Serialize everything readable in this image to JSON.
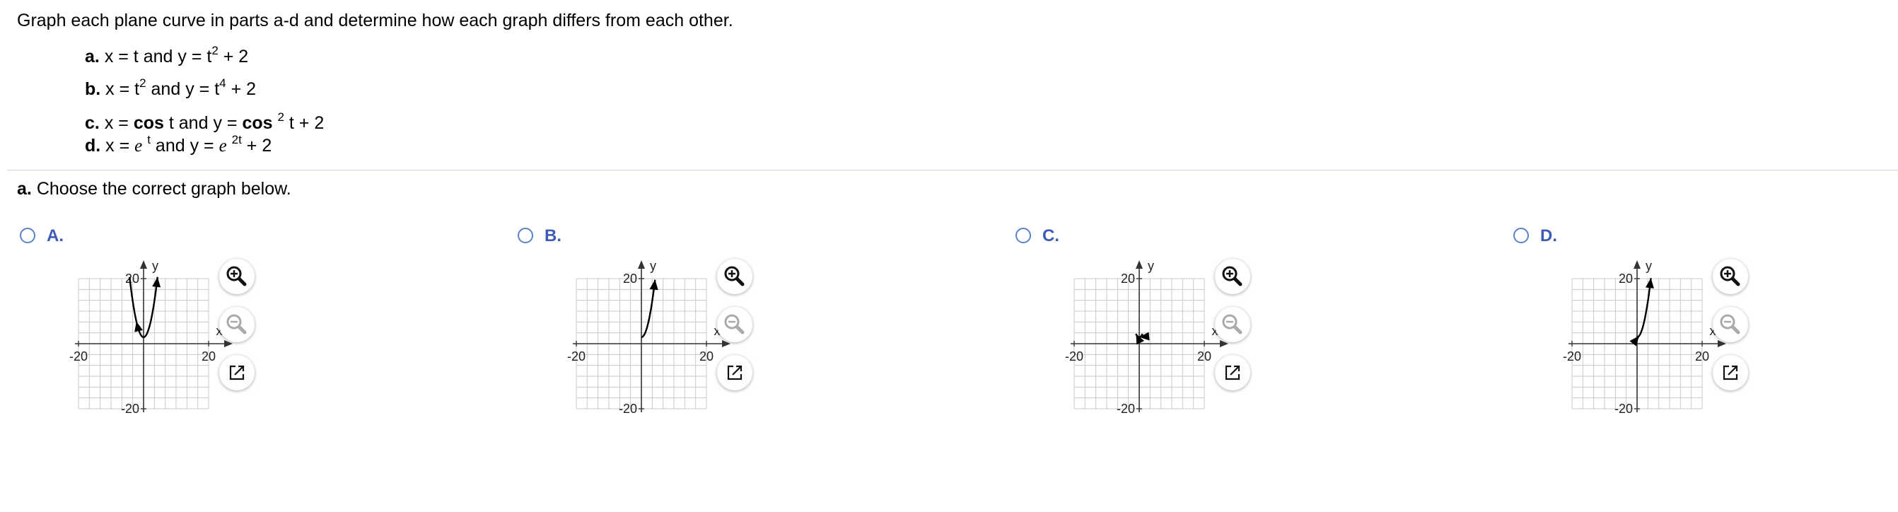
{
  "instruction": "Graph each plane curve in parts a-d and determine how each graph differs from each other.",
  "parts": [
    {
      "letter": "a.",
      "x_expr": "x = t",
      "y_expr": "y = t",
      "y_exp": "2",
      "y_tail": "+ 2"
    },
    {
      "letter": "b.",
      "x_expr": "x = t",
      "x_exp": "2",
      "y_expr": "y = t",
      "y_exp": "4",
      "y_tail": "+ 2"
    },
    {
      "letter": "c.",
      "x_pre": "x = ",
      "x_fn": "cos",
      "x_var": "t",
      "y_pre": "y = ",
      "y_fn": "cos",
      "y_exp": "2",
      "y_tail": "t + 2"
    },
    {
      "letter": "d.",
      "x_pre": "x = ",
      "x_fn": "e",
      "x_exp": "t",
      "y_pre": "y = ",
      "y_fn": "e",
      "y_exp": "2t",
      "y_tail": "+ 2"
    }
  ],
  "connector": "and",
  "question": {
    "letter": "a.",
    "text": "Choose the correct graph below."
  },
  "options": [
    {
      "label": "A.",
      "variant": "a"
    },
    {
      "label": "B.",
      "variant": "b"
    },
    {
      "label": "C.",
      "variant": "c"
    },
    {
      "label": "D.",
      "variant": "d"
    }
  ],
  "axis": {
    "x_label": "x",
    "y_label": "y",
    "x_min": "-20",
    "x_max": "20",
    "y_max": "20",
    "y_min": "-20"
  },
  "colors": {
    "radio_border": "#5b82c4",
    "option_label": "#3e5bb5",
    "grid": "#c8c8c8",
    "divider": "#cfd4e0"
  },
  "icons": {
    "zoom_in": "zoom-in-icon",
    "zoom_out": "zoom-out-icon",
    "popout": "popout-icon"
  }
}
